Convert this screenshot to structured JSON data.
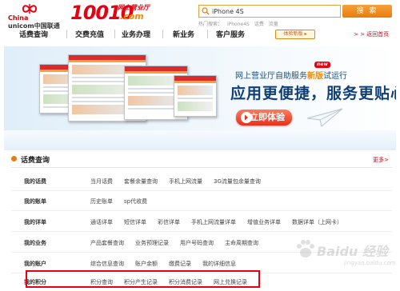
{
  "header": {
    "logo_en_prefix": "China",
    "logo_en_suffix": "unicom中国联通",
    "brand_number": "10010",
    "brand_sub": "网上营业厅",
    "brand_domain": ".com",
    "search_value": "iPhone 4S",
    "search_button": "搜 索",
    "hot_search": [
      "热门搜索：",
      "iPhone4S",
      "话费",
      "流量"
    ]
  },
  "nav": {
    "items": [
      "话费查询",
      "交费充值",
      "业务办理",
      "新业务",
      "客户服务"
    ],
    "badge": "体验新版 ▸",
    "back_home": "> > 返回首页"
  },
  "banner": {
    "title_prefix": "网上营业厅自助服务",
    "title_highlight": "新版",
    "title_suffix": "试运行",
    "new_tag": "new",
    "slogan": "应用更便捷，服务更贴心！",
    "trial_button": "立即体验"
  },
  "section": {
    "title": "话费查询",
    "more": "更多>"
  },
  "rows": [
    {
      "label": "我的话费",
      "links": [
        "当月话费",
        "套餐余量查询",
        "手机上网流量",
        "3G流量包余量查询"
      ]
    },
    {
      "label": "我的账单",
      "links": [
        "历史账单",
        "sp代收费"
      ]
    },
    {
      "label": "我的详单",
      "links": [
        "通话详单",
        "短信详单",
        "彩信详单",
        "手机上网流量详单",
        "增值业务详单",
        "数据详单（上网卡）"
      ]
    },
    {
      "label": "我的业务",
      "links": [
        "产品套餐查询",
        "业务预理记录",
        "用户号码查询",
        "主命周期查询"
      ]
    },
    {
      "label": "我的账户",
      "links": [
        "综合信息查询",
        "账户余额",
        "缴费记录",
        "我的详细信息"
      ]
    },
    {
      "label": "我的积分",
      "links": [
        "积分查询",
        "积分产生记录",
        "积分消费记录",
        "网上兑换记录"
      ]
    }
  ],
  "watermark": {
    "text": "Baidu 经验",
    "sub": "jingyan.baidu.com"
  },
  "colors": {
    "accent_red": "#e60012",
    "accent_orange": "#e77d0c",
    "slogan_blue": "#0f3f76"
  }
}
